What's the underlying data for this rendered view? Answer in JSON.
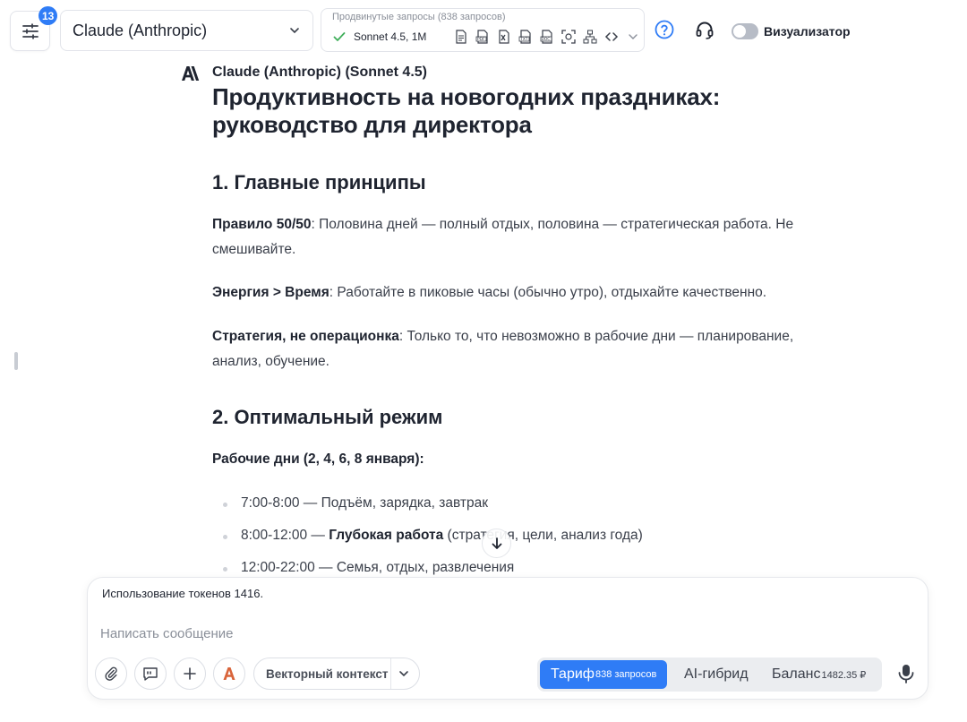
{
  "topbar": {
    "settings_badge": "13",
    "model_select": "Claude (Anthropic)",
    "advanced_title": "Продвинутые запросы (838 запросов)",
    "advanced_model": "Sonnet 4.5, 1M",
    "visualizer_label": "Визуализатор",
    "visualizer_on": false
  },
  "message": {
    "author": "Claude (Anthropic) (Sonnet 4.5)",
    "title": "Продуктивность на новогодних праздниках: руководство для директора",
    "section1_heading": "1. Главные принципы",
    "p1_bold": "Правило 50/50",
    "p1_text": ": Половина дней — полный отдых, половина — стратегическая работа. Не смешивайте.",
    "p2_bold": "Энергия > Время",
    "p2_text": ": Работайте в пиковые часы (обычно утро), отдыхайте качественно.",
    "p3_bold": "Стратегия, не операционка",
    "p3_text": ": Только то, что невозможно в рабочие дни — планирование, анализ, обучение.",
    "section2_heading": "2. Оптимальный режим",
    "workdays_label": "Рабочие дни (2, 4, 6, 8 января):",
    "list": [
      {
        "prefix": "7:00-8:00 — Подъём, зарядка, завтрак",
        "bold": "",
        "suffix": ""
      },
      {
        "prefix": "8:00-12:00 — ",
        "bold": "Глубокая работа",
        "suffix": " (стратегия, цели, анализ года)"
      },
      {
        "prefix": "12:00-22:00 — Семья, отдых, развлечения",
        "bold": "",
        "suffix": ""
      }
    ]
  },
  "composer": {
    "token_usage": "Использование токенов 1416.",
    "placeholder": "Написать сообщение",
    "vector_context": "Векторный контекст",
    "tabs": {
      "tariff": "Тариф",
      "tariff_sup": "838 запросов",
      "hybrid": "AI-гибрид",
      "balance": "Баланс",
      "balance_sup": "1482.35 ₽"
    }
  },
  "colors": {
    "accent": "#2f7cf6",
    "check": "#3fae5a",
    "anthropic_orange": "#d9643a"
  }
}
